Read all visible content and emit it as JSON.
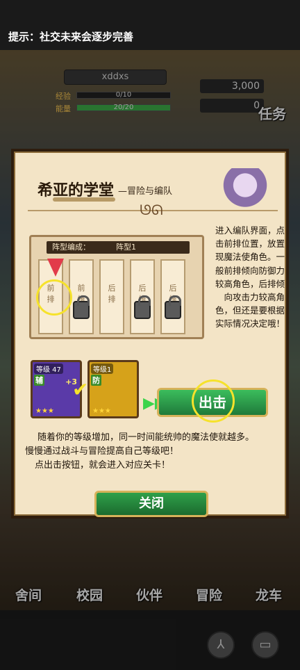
{
  "hint": {
    "text": "提示：社交未来会逐步完善"
  },
  "hud": {
    "player_name": "xddxs",
    "exp_label": "经验",
    "exp_value": "0/10",
    "exp_fraction": 0,
    "energy_label": "能量",
    "energy_value": "20/20",
    "energy_fraction": 1,
    "gold": "3,000",
    "gem": "0",
    "task_label": "任务"
  },
  "dialog": {
    "title": "希亚的学堂",
    "subtitle": "—冒险与编队",
    "divider_ornament": "ᘎᘏ",
    "formation": {
      "header_label": "阵型编成：",
      "preset_label": "阵型1",
      "slots": [
        {
          "label": "前\n排",
          "locked": false
        },
        {
          "label": "前\n排",
          "locked": true
        },
        {
          "label": "后\n排",
          "locked": false
        },
        {
          "label": "后\n排",
          "locked": true
        },
        {
          "label": "后\n排",
          "locked": true
        }
      ]
    },
    "side_text": "进入编队界面，点击前排位置，放置现魔法使角色。一般前排倾向防御力较高角色，后排倾向攻击力较高角色，但还是要根据实际情况决定哦！",
    "cards": [
      {
        "level": "等级 47",
        "role": "辅",
        "bonus": "+3",
        "stars": "★★★",
        "color": "#5a3aa8"
      },
      {
        "level": "等级1",
        "role": "防",
        "bonus": "",
        "stars": "★★★",
        "color": "#d6a21a"
      }
    ],
    "checkmark": "✔",
    "play_arrow": "▶▶",
    "sortie_button": "出击",
    "body_lines": [
      "随着你的等级增加，同一时间能统帅的魔法使就越多。",
      "慢慢通过战斗与冒险提高自己等级吧！",
      "点出击按钮，就会进入对应关卡！"
    ],
    "close_button": "关闭"
  },
  "bottom_nav": {
    "items": [
      "舍间",
      "校园",
      "伙伴",
      "冒险",
      "龙车"
    ]
  },
  "footer": {
    "left_icon": "skill-icon",
    "right_icon": "book-icon"
  }
}
